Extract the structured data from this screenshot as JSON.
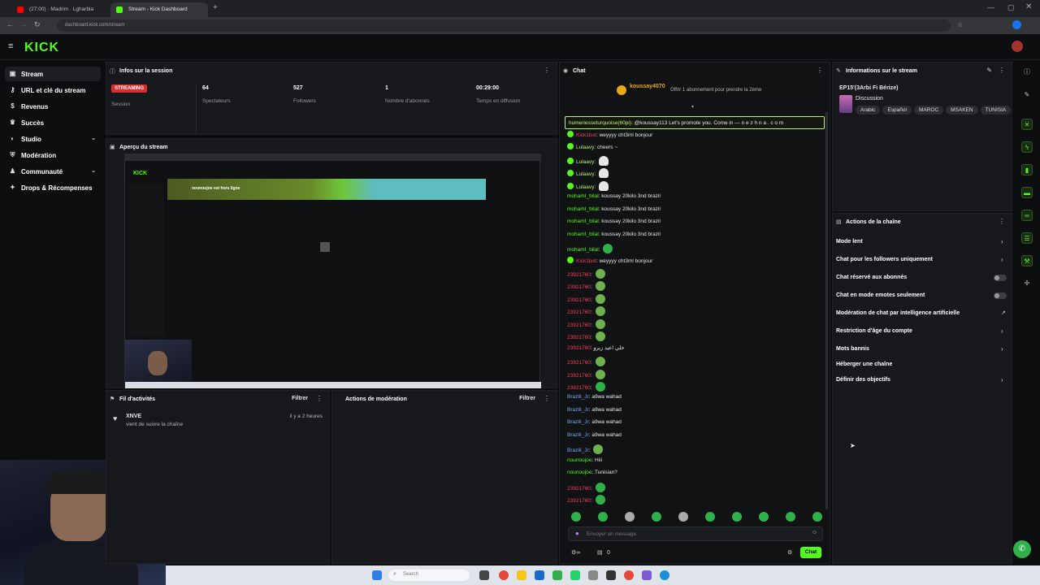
{
  "browser": {
    "tabs": [
      {
        "label": "(27:00) · Madrim · Lgharbia",
        "active": false
      },
      {
        "label": "Stream - Kick Dashboard",
        "active": true
      }
    ],
    "url": "dashboard.kick.com/stream"
  },
  "brand": {
    "logo": "KICK",
    "accent": "#53fc18"
  },
  "sidebar": {
    "items": [
      {
        "label": "Stream",
        "icon": "camera-icon",
        "active": true
      },
      {
        "label": "URL et clé du stream",
        "icon": "key-icon"
      },
      {
        "label": "Revenus",
        "icon": "money-icon"
      },
      {
        "label": "Succès",
        "icon": "trophy-icon"
      },
      {
        "label": "Studio",
        "icon": "studio-icon",
        "expandable": true
      },
      {
        "label": "Modération",
        "icon": "shield-icon"
      },
      {
        "label": "Communauté",
        "icon": "community-icon",
        "expandable": true
      },
      {
        "label": "Drops & Récompenses",
        "icon": "gift-icon"
      }
    ]
  },
  "session": {
    "title": "Infos sur la session",
    "status_badge": "STREAMING",
    "status_label": "Session",
    "stats": [
      {
        "value": "64",
        "label": "Spectateurs"
      },
      {
        "value": "527",
        "label": "Followers"
      },
      {
        "value": "1",
        "label": "Nombre d'abonnés"
      },
      {
        "value": "00:29:00",
        "label": "Temps en diffusion"
      }
    ]
  },
  "preview": {
    "title": "Aperçu du stream",
    "inner_banner": "nounoujoe est hors ligne"
  },
  "activity": {
    "title": "Fil d'activités",
    "filter_label": "Filtrer",
    "items": [
      {
        "user": "XNVE",
        "text": "vient de suivre la chaîne",
        "time": "il y a 2 heures"
      }
    ]
  },
  "moderation": {
    "title": "Actions de modération",
    "filter_label": "Filtrer"
  },
  "chat": {
    "title": "Chat",
    "pinned_user": "koussay4070",
    "pinned_text": "Offrir 1 abonnement pour prendre la 2ème",
    "highlight": {
      "user": "humeriesseturquoise(60pi)",
      "text": "@koussay113 Let's promote you. Come in — n e z h n a . c o m"
    },
    "messages": [
      {
        "user": "Kick1bot",
        "text": "weyyyy cht3ml bonjour",
        "color": "red",
        "badge": true
      },
      {
        "user": "Lulaavy",
        "text": "cheers ~",
        "color": "lime",
        "badge": true
      },
      {
        "user": "Lulaavy",
        "text": "",
        "color": "lime",
        "badge": true,
        "emote": "ghost"
      },
      {
        "user": "Lulaavy",
        "text": "",
        "color": "lime",
        "badge": true,
        "emote": "ghost"
      },
      {
        "user": "Lulaavy",
        "text": "",
        "color": "lime",
        "badge": true,
        "emote": "ghost"
      },
      {
        "user": "mohamI_bilal",
        "text": "koussay 20kilo 3nd brazil",
        "color": "green"
      },
      {
        "user": "mohamI_bilal",
        "text": "koussay 20kilo 3nd brazil",
        "color": "green"
      },
      {
        "user": "mohamI_bilal",
        "text": "koussay 20kilo 3nd brazil",
        "color": "green"
      },
      {
        "user": "mohamI_bilal",
        "text": "koussay 20kilo 3nd brazil",
        "color": "green"
      },
      {
        "user": "mohamI_bilal",
        "text": "",
        "color": "green",
        "emote": "green"
      },
      {
        "user": "Kick1bot",
        "text": "weyyyy cht3ml bonjour",
        "color": "red",
        "badge": true
      },
      {
        "user": "23921760",
        "text": "",
        "color": "red",
        "emote": "pepe"
      },
      {
        "user": "23921760",
        "text": "",
        "color": "red",
        "emote": "pepe"
      },
      {
        "user": "23921760",
        "text": "",
        "color": "red",
        "emote": "pepe"
      },
      {
        "user": "23921760",
        "text": "",
        "color": "red",
        "emote": "pepe"
      },
      {
        "user": "23921760",
        "text": "",
        "color": "red",
        "emote": "pepe"
      },
      {
        "user": "23921760",
        "text": "",
        "color": "red",
        "emote": "pepe"
      },
      {
        "user": "23921760",
        "text": "خلي اعيد زيرو",
        "color": "red"
      },
      {
        "user": "23921760",
        "text": "",
        "color": "red",
        "emote": "pepe"
      },
      {
        "user": "23921760",
        "text": "",
        "color": "red",
        "emote": "pepe"
      },
      {
        "user": "23921760",
        "text": "",
        "color": "red",
        "emote": "green"
      },
      {
        "user": "Brazili_Jr",
        "text": "a9wa wahad",
        "color": "blue"
      },
      {
        "user": "Brazili_Jr",
        "text": "a9wa wahad",
        "color": "blue"
      },
      {
        "user": "Brazili_Jr",
        "text": "a9wa wahad",
        "color": "blue"
      },
      {
        "user": "Brazili_Jr",
        "text": "a9wa wahad",
        "color": "blue"
      },
      {
        "user": "Brazili_Jr",
        "text": "",
        "color": "blue",
        "emote": "pepe"
      },
      {
        "user": "nounoujoe",
        "text": "Hiii",
        "color": "green"
      },
      {
        "user": "nounoujoe",
        "text": "Tunisian?",
        "color": "green"
      },
      {
        "user": "23921760",
        "text": "",
        "color": "red",
        "emote": "green"
      },
      {
        "user": "23921760",
        "text": "",
        "color": "red",
        "emote": "green"
      }
    ],
    "input_placeholder": "Envoyer un message",
    "viewer_count": "0",
    "send_label": "Chat"
  },
  "stream_info": {
    "title": "Informations sur le stream",
    "stream_title": "EP15'(3Arbi Fi Bérize)",
    "category": "Discussion",
    "tags": [
      "Arabic",
      "Español",
      "MAROC",
      "MSAKEN",
      "TUNISIA"
    ]
  },
  "channel_actions": {
    "title": "Actions de la chaîne",
    "items": [
      {
        "label": "Mode lent",
        "control": "chevron"
      },
      {
        "label": "Chat pour les followers uniquement",
        "control": "chevron"
      },
      {
        "label": "Chat réservé aux abonnés",
        "control": "toggle"
      },
      {
        "label": "Chat en mode emotes seulement",
        "control": "toggle"
      },
      {
        "label": "Modération de chat par intelligence artificielle",
        "control": "external"
      },
      {
        "label": "Restriction d'âge du compte",
        "control": "chevron"
      },
      {
        "label": "Mots bannis",
        "control": "chevron"
      },
      {
        "label": "Héberger une chaîne",
        "control": "none"
      },
      {
        "label": "Définir des objectifs",
        "control": "chevron"
      }
    ]
  },
  "taskbar": {
    "search_placeholder": "Search"
  }
}
